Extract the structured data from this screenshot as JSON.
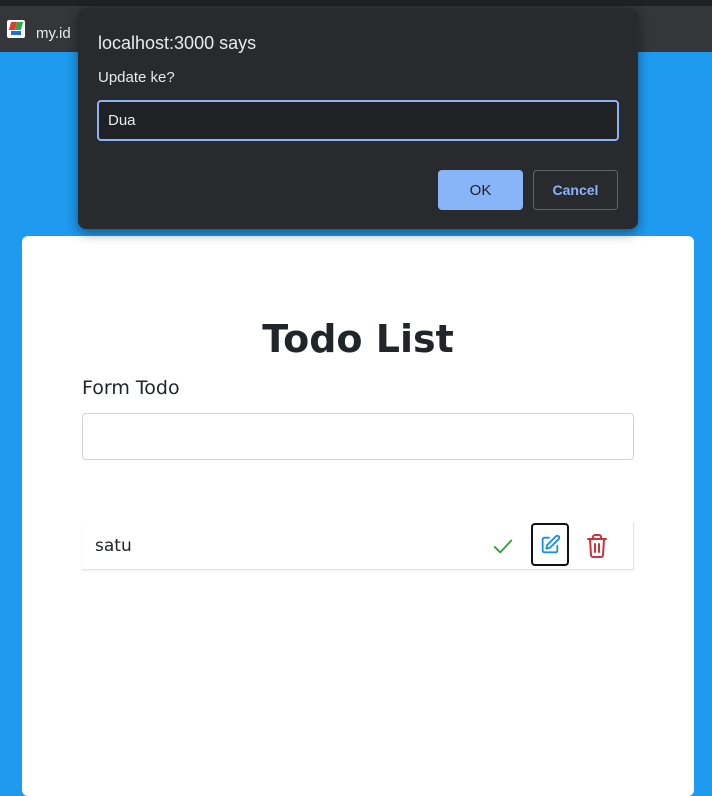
{
  "browser": {
    "tab_title": "my.id",
    "favicon_icon": "app-logo-icon"
  },
  "app": {
    "title": "Todo List",
    "form_label": "Form Todo",
    "input_value": "",
    "todos": [
      {
        "text": "satu",
        "done": false
      }
    ],
    "icons": {
      "complete": "check-icon",
      "edit": "edit-icon",
      "delete": "trash-icon"
    },
    "colors": {
      "page_background": "#1e9bf0",
      "check": "#3a9a44",
      "edit": "#1a8fe0",
      "delete": "#d0303e"
    }
  },
  "dialog": {
    "origin": "localhost:3000 says",
    "message": "Update ke?",
    "input_value": "Dua",
    "ok_label": "OK",
    "cancel_label": "Cancel",
    "colors": {
      "background": "#292a2d",
      "accent": "#8ab4f8"
    }
  }
}
